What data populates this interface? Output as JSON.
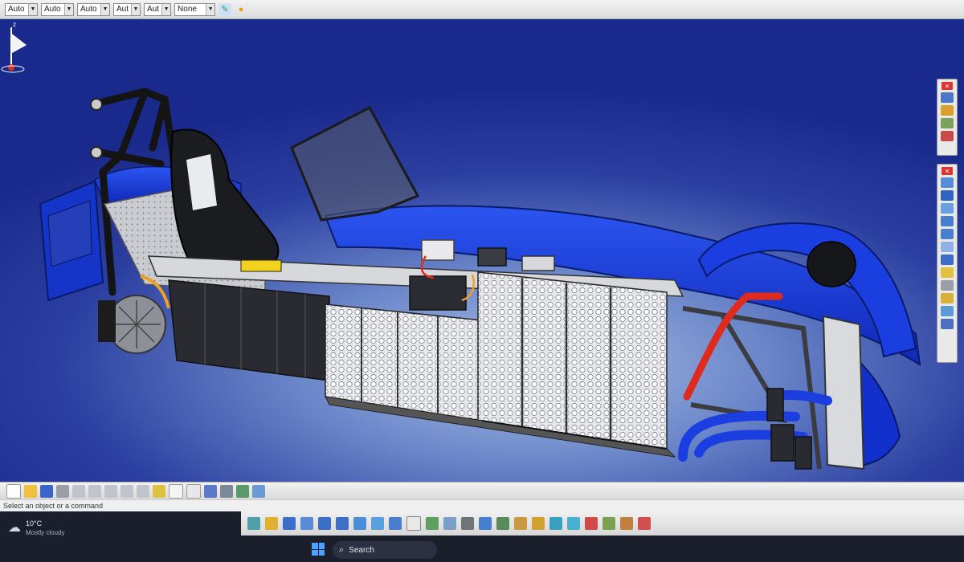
{
  "top_toolbar": {
    "combos": [
      "Auto",
      "Auto",
      "Auto",
      "Aut",
      "Aut",
      "None"
    ]
  },
  "viewport": {
    "background_colors": [
      "#1a2a8c",
      "#a9bfe6"
    ],
    "compass_axis": "z"
  },
  "status": {
    "command_prompt": "Select an object or a command"
  },
  "taskbar": {
    "weather_temp": "10°C",
    "weather_desc": "Mostly cloudy",
    "search_label": "Search"
  },
  "colors": {
    "body_blue": "#1f3fd6",
    "frame_red": "#e02a1e",
    "toolbar_bg": "#e4e4e4",
    "taskbar_bg": "#1b1f2b"
  },
  "icons": [
    "save-icon",
    "open-icon",
    "new-icon",
    "formula-icon",
    "zoom-in-icon",
    "zoom-out-icon",
    "rotate-icon",
    "pan-icon",
    "fit-all-icon",
    "search-icon",
    "windows-icon",
    "weather-icon"
  ]
}
